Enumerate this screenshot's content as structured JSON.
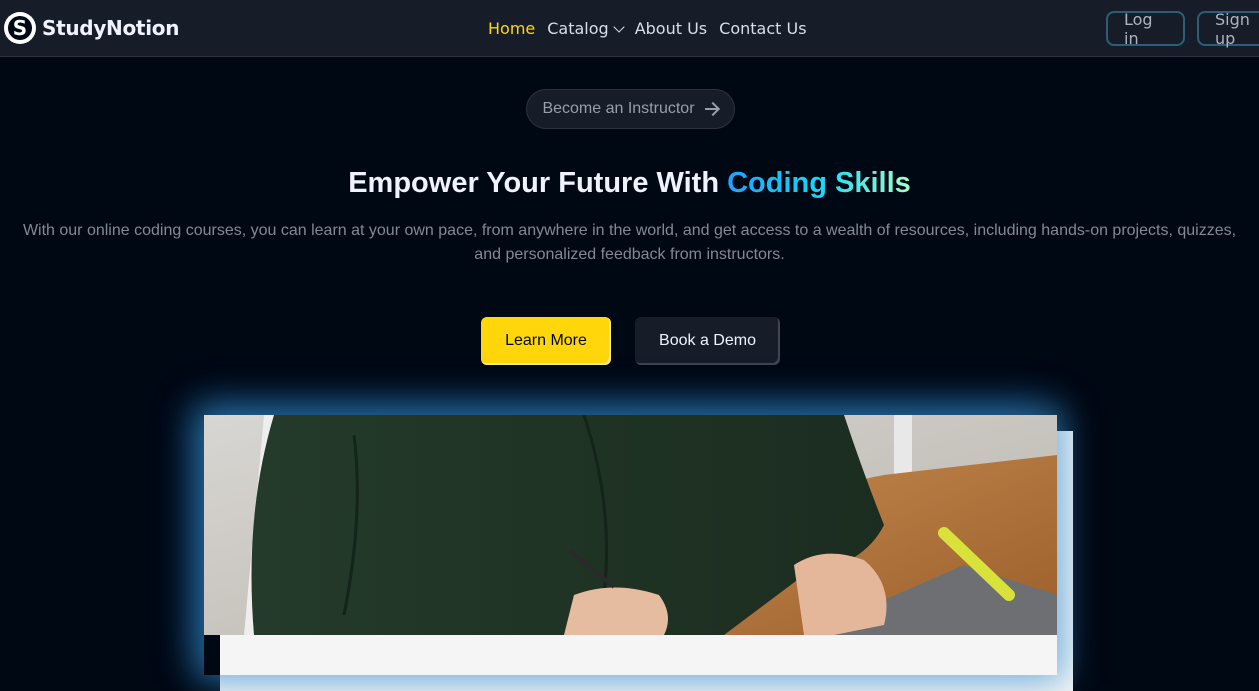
{
  "brand": {
    "name": "StudyNotion",
    "logo_letter": "S"
  },
  "nav": {
    "links": [
      {
        "label": "Home",
        "active": true
      },
      {
        "label": "Catalog",
        "dropdown": true
      },
      {
        "label": "About Us"
      },
      {
        "label": "Contact Us"
      }
    ],
    "login_label": "Log in",
    "signup_label": "Sign up"
  },
  "hero": {
    "instructor_cta": "Become an Instructor",
    "headline_prefix": "Empower Your Future With ",
    "headline_highlight": "Coding Skills",
    "subtext": "With our online coding courses, you can learn at your own pace, from anywhere in the world, and get access to a wealth of resources, including hands-on projects, quizzes, and personalized feedback from instructors.",
    "learn_more_label": "Learn More",
    "book_demo_label": "Book a Demo"
  },
  "colors": {
    "accent_yellow": "#ffd60a",
    "navbar_bg": "#161d29",
    "page_bg": "#000814",
    "gradient": [
      "#1fa2ff",
      "#12d8fa",
      "#a6ffcb"
    ]
  }
}
